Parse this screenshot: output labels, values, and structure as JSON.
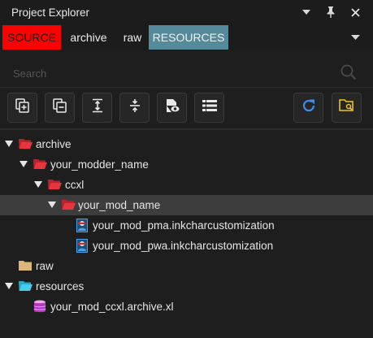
{
  "panel": {
    "title": "Project Explorer"
  },
  "tabs": [
    {
      "label": "SOURCE",
      "color": "#ff0000"
    },
    {
      "label": "archive"
    },
    {
      "label": "raw"
    },
    {
      "label": "RESOURCES",
      "color": "#548a99"
    }
  ],
  "search": {
    "placeholder": "Search"
  },
  "tree": [
    {
      "label": "archive",
      "icon": "folder-open-icon",
      "icon_color": "#e0303a",
      "expanded": true,
      "depth": 0
    },
    {
      "label": "your_modder_name",
      "icon": "folder-open-icon",
      "icon_color": "#e0303a",
      "expanded": true,
      "depth": 1
    },
    {
      "label": "ccxl",
      "icon": "folder-open-icon",
      "icon_color": "#e0303a",
      "expanded": true,
      "depth": 2
    },
    {
      "label": "your_mod_name",
      "icon": "folder-open-icon",
      "icon_color": "#e0303a",
      "expanded": true,
      "depth": 3,
      "selected": true
    },
    {
      "label": "your_mod_pma.inkcharcustomization",
      "icon": "character-file-icon",
      "depth": 4
    },
    {
      "label": "your_mod_pwa.inkcharcustomization",
      "icon": "character-file-icon",
      "depth": 4
    },
    {
      "label": "raw",
      "icon": "folder-closed-icon",
      "icon_color": "#dcb67a",
      "depth": 0
    },
    {
      "label": "resources",
      "icon": "folder-open-icon",
      "icon_color": "#3fc6e8",
      "expanded": true,
      "depth": 0
    },
    {
      "label": "your_mod_ccxl.archive.xl",
      "icon": "archive-xl-icon",
      "depth": 1
    }
  ]
}
